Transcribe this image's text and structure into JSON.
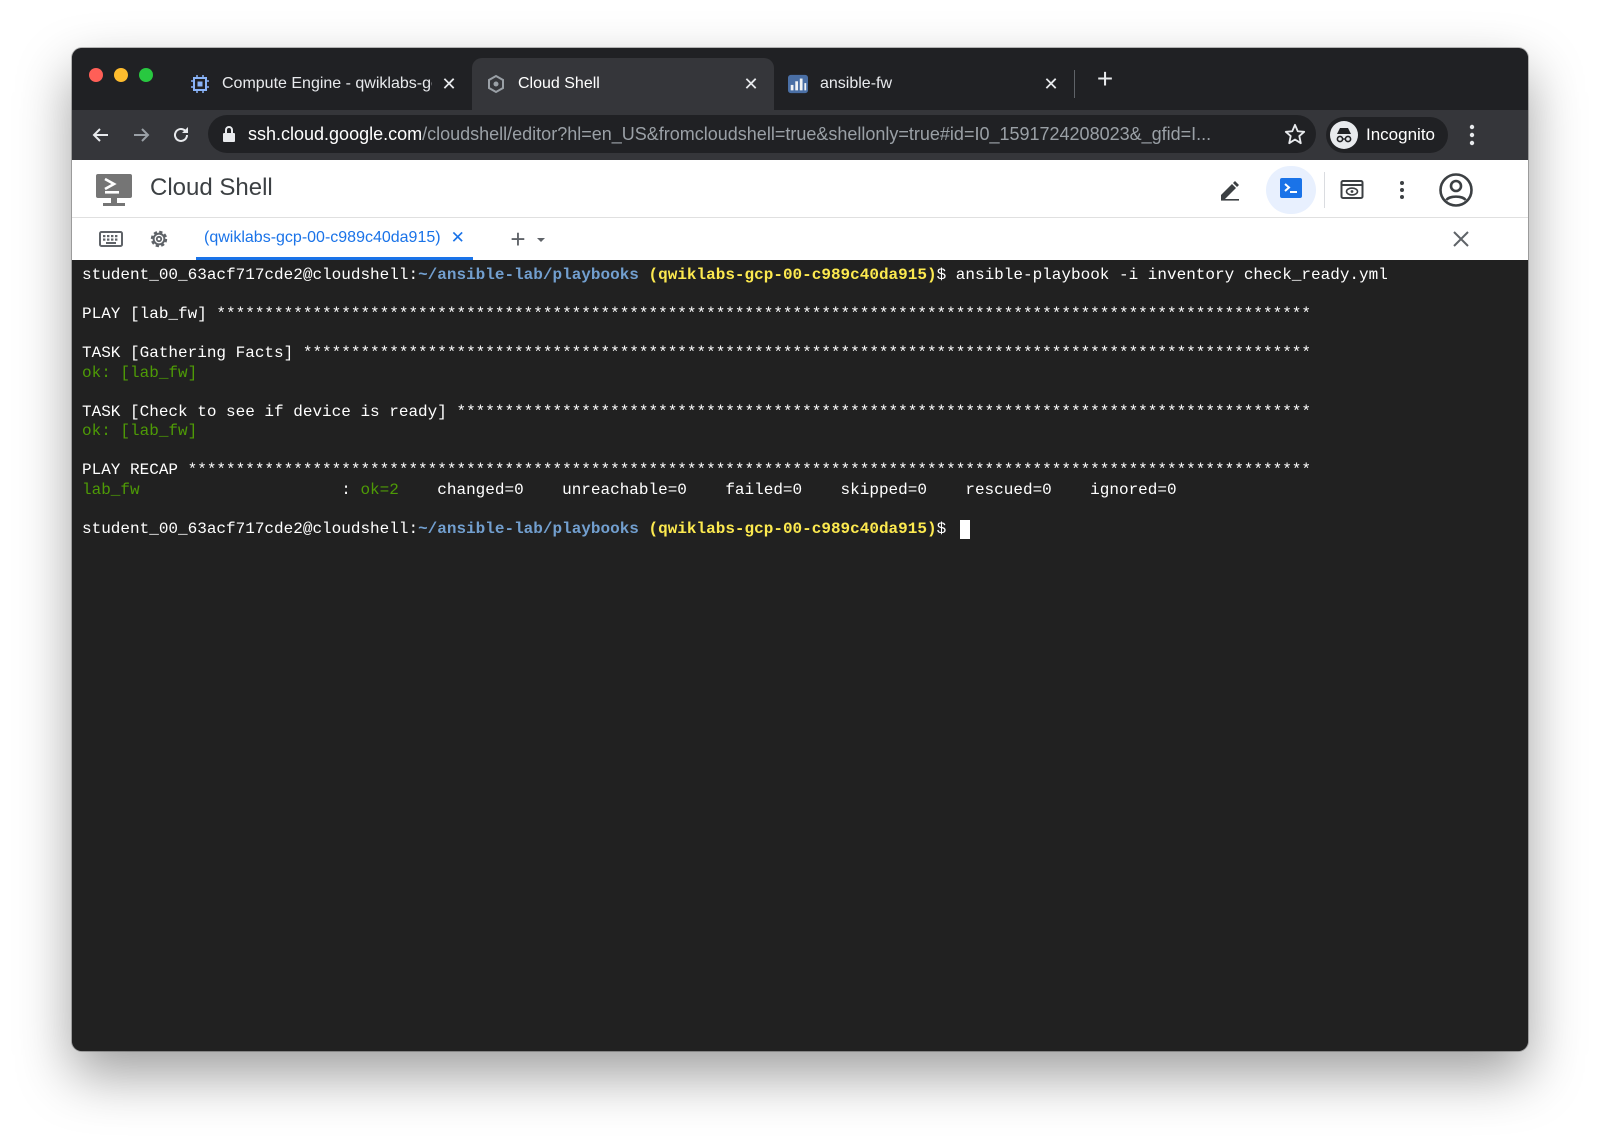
{
  "browser": {
    "tabs": [
      {
        "title": "Compute Engine - qwiklabs-gc",
        "favicon": "compute-engine-chip-icon",
        "active": false
      },
      {
        "title": "Cloud Shell",
        "favicon": "cloud-shell-hex-icon",
        "active": true
      },
      {
        "title": "ansible-fw",
        "favicon": "ansible-fw-chart-icon",
        "active": false
      }
    ],
    "url_host": "ssh.cloud.google.com",
    "url_rest": "/cloudshell/editor?hl=en_US&fromcloudshell=true&shellonly=true#id=I0_1591724208023&_gfid=I...",
    "incognito_label": "Incognito"
  },
  "cloudshell": {
    "title": "Cloud Shell",
    "session_tab": "(qwiklabs-gcp-00-c989c40da915)",
    "accent": "#1a73e8"
  },
  "terminal": {
    "prompt_user": "student_00_63acf717cde2@cloudshell:",
    "prompt_path": "~/ansible-lab/playbooks",
    "prompt_project": "(qwiklabs-gcp-00-c989c40da915)",
    "prompt_symbol": "$ ",
    "command": "ansible-playbook -i inventory check_ready.yml",
    "play_header": "PLAY [lab_fw] ******************************************************************************************************************",
    "task1_header": "TASK [Gathering Facts] *********************************************************************************************************",
    "task1_result": "ok: [lab_fw]",
    "task2_header": "TASK [Check to see if device is ready] *****************************************************************************************",
    "task2_result": "ok: [lab_fw]",
    "recap_header": "PLAY RECAP *********************************************************************************************************************",
    "recap_host": "lab_fw",
    "recap_gap": "                     : ",
    "recap_ok": "ok=2",
    "recap_rest": "    changed=0    unreachable=0    failed=0    skipped=0    rescued=0    ignored=0",
    "colors": {
      "path": "#729fcf",
      "project": "#fce94f",
      "ok": "#4e9a06",
      "text": "#ffffff",
      "background": "#212121"
    }
  }
}
